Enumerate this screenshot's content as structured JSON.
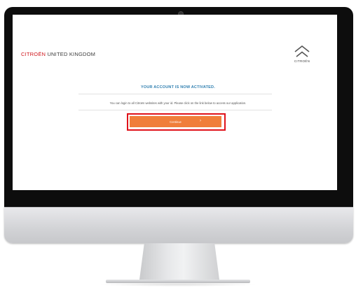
{
  "brand": {
    "name_red": "CITROËN",
    "name_gray": " UNITED KINGDOM",
    "logo_text": "CITROËN"
  },
  "message": {
    "heading": "YOUR ACCOUNT IS NOW ACTIVATED.",
    "info": "You can login to all Citroën websites with your id. Please click on the link below to access our application."
  },
  "actions": {
    "continue_label": "Continue",
    "continue_arrow": "›"
  },
  "colors": {
    "brand_red": "#d0191f",
    "heading_blue": "#2f7fb0",
    "button_orange": "#f07e3a",
    "highlight_red": "#e0121a"
  }
}
